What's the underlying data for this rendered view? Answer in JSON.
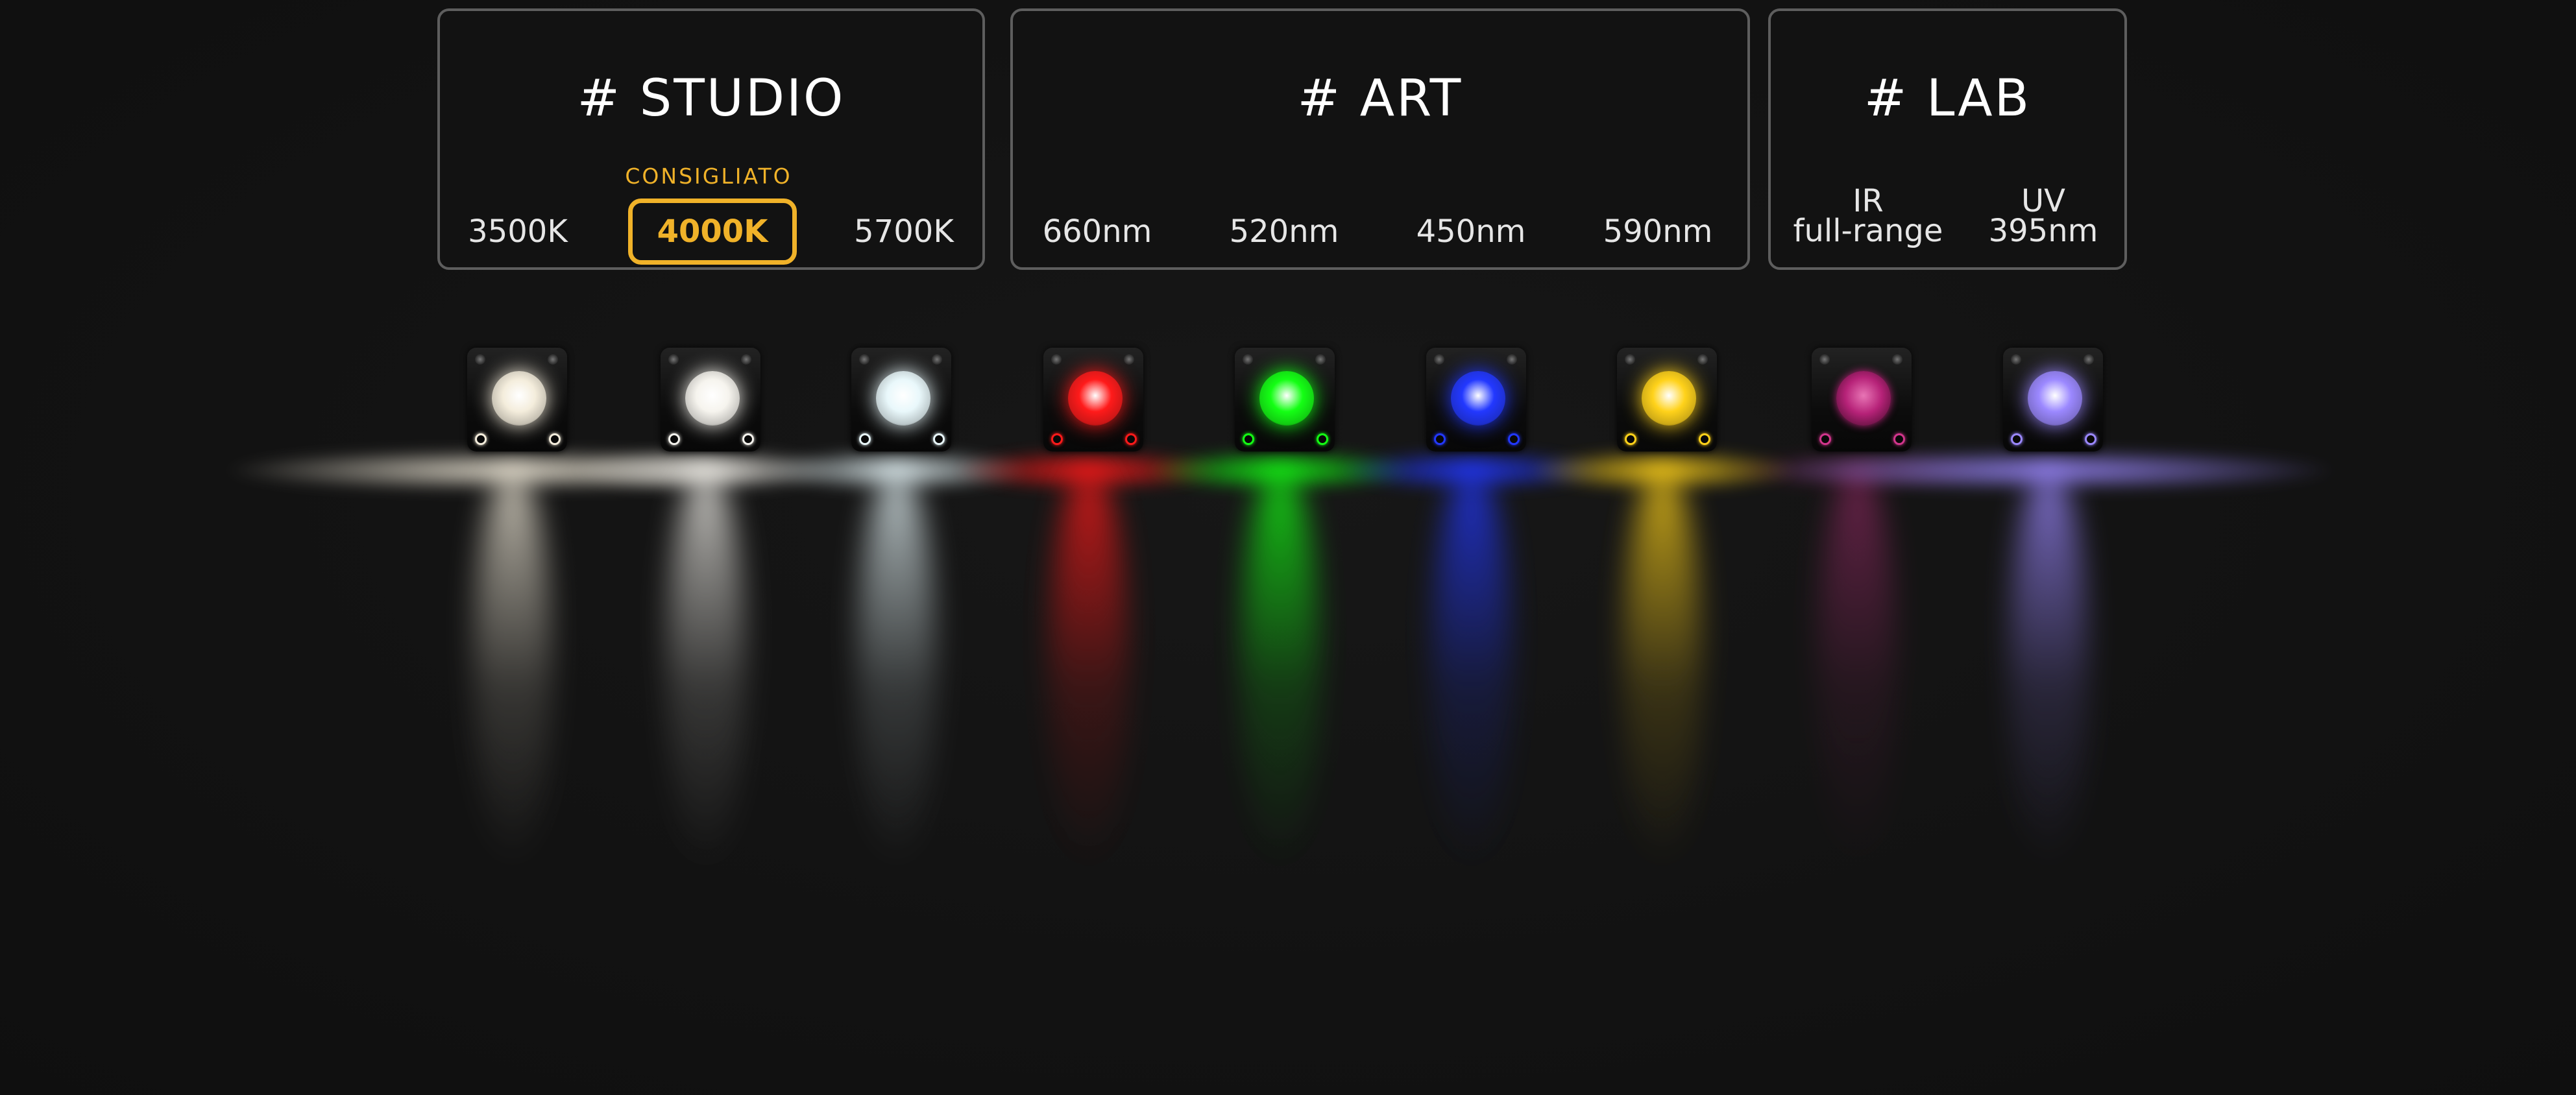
{
  "panels": {
    "studio": {
      "title": "# STUDIO",
      "recommended_label": "CONSIGLIATO",
      "options": [
        "3500K",
        "4000K",
        "5700K"
      ],
      "selected": "4000K"
    },
    "art": {
      "title": "# ART",
      "options": [
        "660nm",
        "520nm",
        "450nm",
        "590nm"
      ]
    },
    "lab": {
      "title": "# LAB",
      "options": [
        {
          "line1": "IR",
          "line2": "full-range"
        },
        {
          "line1": "UV",
          "line2": "395nm"
        }
      ]
    }
  },
  "colors": {
    "accent": "#f0b229",
    "border": "#5e5e5e",
    "background": "#121212",
    "lights": [
      "#f4eddc",
      "#f6f4ee",
      "#e9f8fb",
      "#ff1a1a",
      "#14ff14",
      "#2238ff",
      "#ffd21a",
      "#d2358c",
      "#9b88ff"
    ]
  }
}
